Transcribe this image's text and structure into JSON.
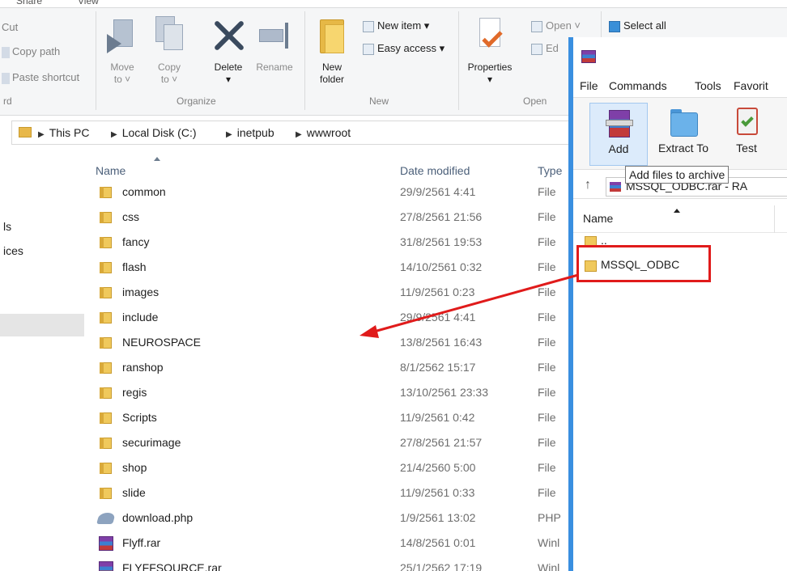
{
  "window": {
    "accent": "#3a8fe0",
    "annotation_color": "#e01b1b"
  },
  "ribbon": {
    "tabs": [
      "Share",
      "View"
    ],
    "clipboard": {
      "items": [
        "Cut",
        "Copy path",
        "Paste shortcut"
      ],
      "group_label": "rd"
    },
    "organize": {
      "move_to": "Move to ˅",
      "copy_to": "Copy to ˅",
      "delete": "Delete",
      "rename": "Rename",
      "group_label": "Organize"
    },
    "new": {
      "new_folder": "New folder",
      "new_item": "New item ▾",
      "easy_access": "Easy access ▾",
      "group_label": "New"
    },
    "open": {
      "properties": "Properties",
      "open": "Open ˅",
      "edit": "Ed",
      "group_label": "Open"
    },
    "select": {
      "select_all": "Select all"
    }
  },
  "address": {
    "crumbs": [
      "This PC",
      "Local Disk (C:)",
      "inetpub",
      "wwwroot"
    ]
  },
  "nav": {
    "fragments": [
      "ls",
      "ices"
    ]
  },
  "list": {
    "columns": {
      "name": "Name",
      "date": "Date modified",
      "type": "Type"
    },
    "rows": [
      {
        "name": "common",
        "date": "29/9/2561 4:41",
        "type": "File",
        "icon": "folder-icon"
      },
      {
        "name": "css",
        "date": "27/8/2561 21:56",
        "type": "File",
        "icon": "folder-icon"
      },
      {
        "name": "fancy",
        "date": "31/8/2561 19:53",
        "type": "File",
        "icon": "folder-icon"
      },
      {
        "name": "flash",
        "date": "14/10/2561 0:32",
        "type": "File",
        "icon": "folder-icon"
      },
      {
        "name": "images",
        "date": "11/9/2561 0:23",
        "type": "File",
        "icon": "folder-icon"
      },
      {
        "name": "include",
        "date": "29/9/2561 4:41",
        "type": "File",
        "icon": "folder-icon"
      },
      {
        "name": "NEUROSPACE",
        "date": "13/8/2561 16:43",
        "type": "File",
        "icon": "folder-icon"
      },
      {
        "name": "ranshop",
        "date": "8/1/2562 15:17",
        "type": "File",
        "icon": "folder-icon"
      },
      {
        "name": "regis",
        "date": "13/10/2561 23:33",
        "type": "File",
        "icon": "folder-icon"
      },
      {
        "name": "Scripts",
        "date": "11/9/2561 0:42",
        "type": "File",
        "icon": "folder-icon"
      },
      {
        "name": "securimage",
        "date": "27/8/2561 21:57",
        "type": "File",
        "icon": "folder-icon"
      },
      {
        "name": "shop",
        "date": "21/4/2560 5:00",
        "type": "File",
        "icon": "folder-icon"
      },
      {
        "name": "slide",
        "date": "11/9/2561 0:33",
        "type": "File",
        "icon": "folder-icon"
      },
      {
        "name": "download.php",
        "date": "1/9/2561 13:02",
        "type": "PHP",
        "icon": "php-file-icon"
      },
      {
        "name": "Flyff.rar",
        "date": "14/8/2561 0:01",
        "type": "Winl",
        "icon": "rar-archive-icon"
      },
      {
        "name": "FLYFFSOURCE.rar",
        "date": "25/1/2562 17:19",
        "type": "Winl",
        "icon": "rar-archive-icon"
      }
    ]
  },
  "winrar": {
    "menu": [
      "File",
      "Commands",
      "Tools",
      "Favorit"
    ],
    "toolbar": {
      "add": "Add",
      "extract_to": "Extract To",
      "test": "Test"
    },
    "tooltip": "Add files to archive",
    "path": "MSSQL_ODBC.rar - RA",
    "column_name": "Name",
    "rows": [
      "..",
      "MSSQL_ODBC"
    ]
  }
}
